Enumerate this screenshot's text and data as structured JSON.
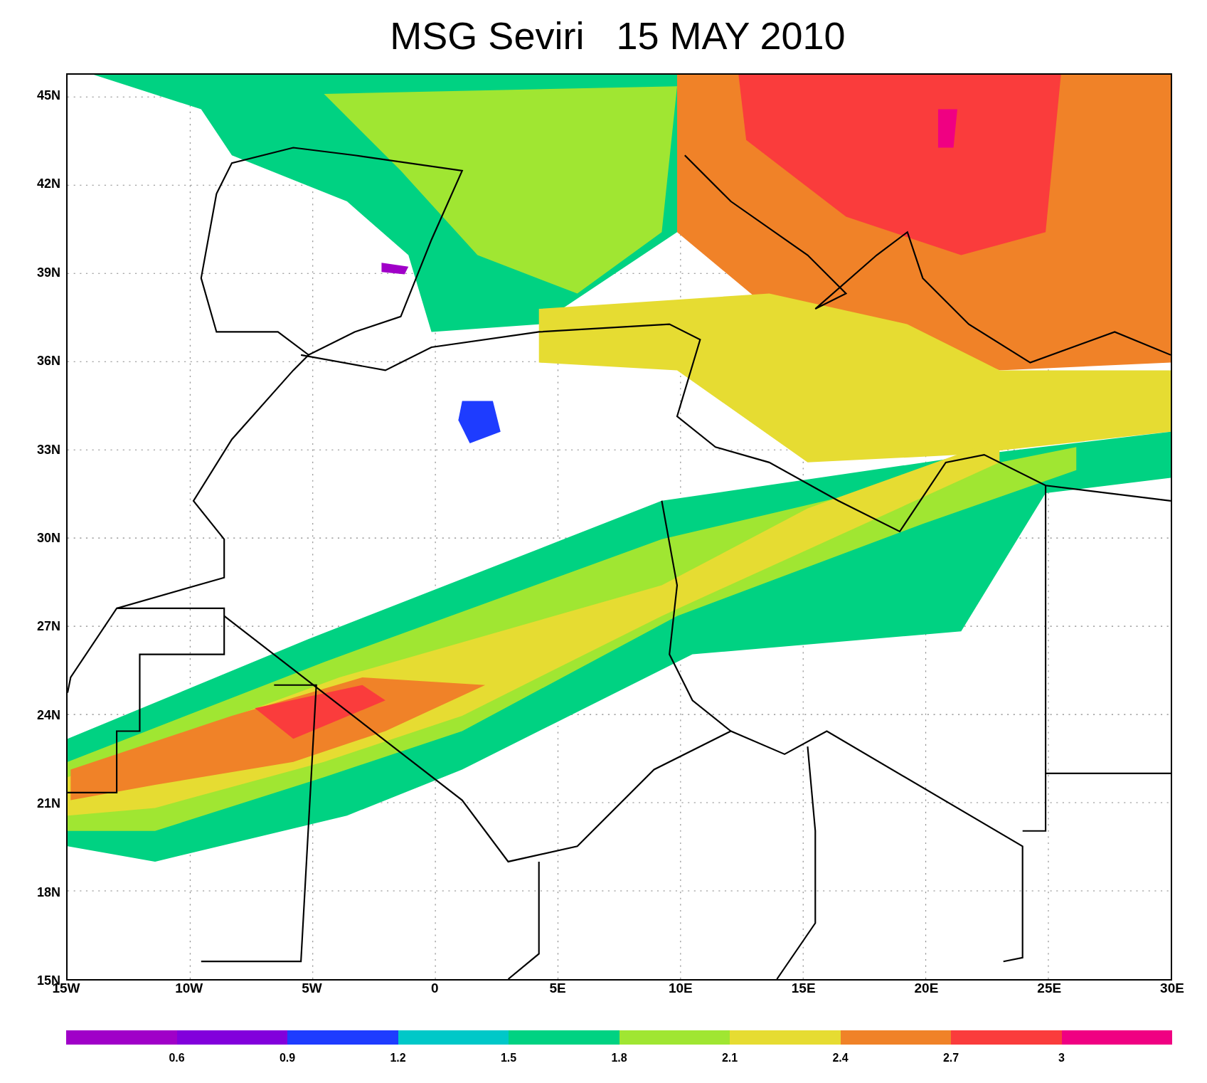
{
  "title": "MSG Seviri   15 MAY 2010",
  "y_axis": {
    "labels": [
      "45N",
      "42N",
      "39N",
      "36N",
      "33N",
      "30N",
      "27N",
      "24N",
      "21N",
      "18N",
      "15N"
    ]
  },
  "x_axis": {
    "labels": [
      "15W",
      "10W",
      "5W",
      "0",
      "5E",
      "10E",
      "15E",
      "20E",
      "25E",
      "30E"
    ]
  },
  "colorbar": {
    "segments": [
      {
        "color": "#a000c8"
      },
      {
        "color": "#8200dc"
      },
      {
        "color": "#1e3cff"
      },
      {
        "color": "#00c8c8"
      },
      {
        "color": "#00d282"
      },
      {
        "color": "#a0e632"
      },
      {
        "color": "#e6dc32"
      },
      {
        "color": "#f08228"
      },
      {
        "color": "#fa3c3c"
      },
      {
        "color": "#f00082"
      }
    ],
    "labels": [
      "0.6",
      "0.9",
      "1.2",
      "1.5",
      "1.8",
      "2.1",
      "2.4",
      "2.7",
      "3"
    ]
  }
}
